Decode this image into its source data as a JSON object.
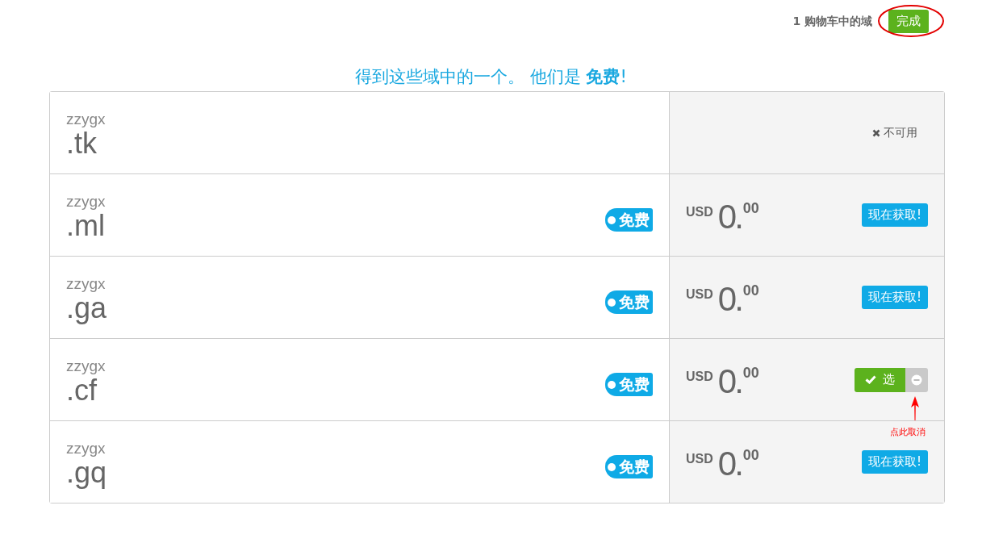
{
  "cart": {
    "count_label": "1 购物车中的域",
    "done_button": "完成",
    "circled": true
  },
  "headline": "得到这些域中的一个。 他们是 **免费**!",
  "domains": [
    {
      "name": "zzygx",
      "tld": ".tk",
      "kind": "unavailable",
      "status": "不可用"
    },
    {
      "name": "zzygx",
      "tld": ".ml",
      "kind": "available",
      "badge": "免费",
      "currency": "USD",
      "price": "0.",
      "cents": "00",
      "selected": false,
      "button": "现在获取!"
    },
    {
      "name": "zzygx",
      "tld": ".ga",
      "kind": "available",
      "badge": "免费",
      "currency": "USD",
      "price": "0.",
      "cents": "00",
      "selected": false,
      "button": "现在获取!"
    },
    {
      "name": "zzygx",
      "tld": ".cf",
      "kind": "available",
      "badge": "免费",
      "currency": "USD",
      "price": "0.",
      "cents": "00",
      "selected": true,
      "button": "选",
      "note": "点此取消"
    },
    {
      "name": "zzygx",
      "tld": ".gq",
      "kind": "available",
      "badge": "免费",
      "currency": "USD",
      "price": "0.",
      "cents": "00",
      "selected": false,
      "button": "现在获取!"
    }
  ]
}
